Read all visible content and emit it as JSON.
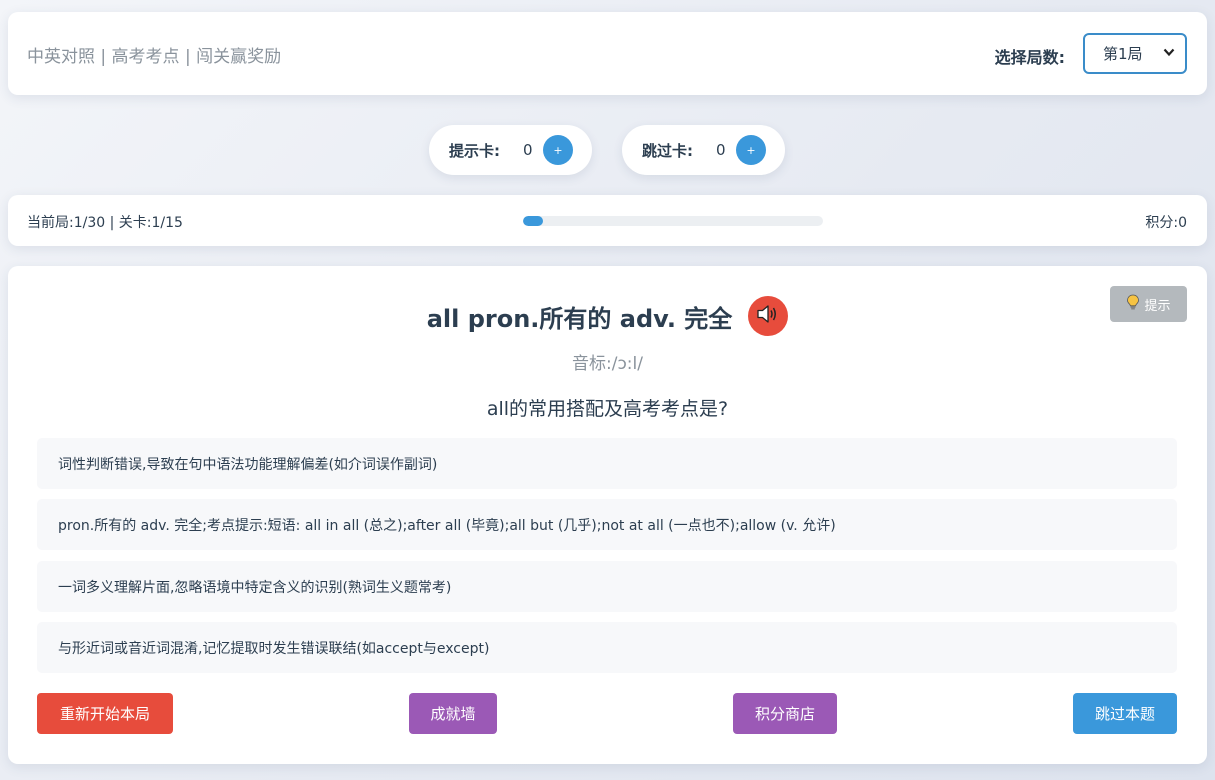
{
  "header": {
    "subtitle": "中英对照 | 高考考点 | 闯关赢奖励",
    "round_label": "选择局数:",
    "round_selected": "第1局"
  },
  "cards": {
    "hint_label": "提示卡:",
    "hint_count": "0",
    "skip_label": "跳过卡:",
    "skip_count": "0",
    "plus_symbol": "+"
  },
  "progress": {
    "text": "当前局:1/30 | 关卡:1/15",
    "fraction": 0.0667,
    "score_text": "积分:0"
  },
  "question": {
    "hint_button": "提示",
    "word": "all pron.所有的 adv. 完全",
    "phonetic": "音标:/ɔ:l/",
    "prompt": "all的常用搭配及高考考点是?",
    "options": [
      "词性判断错误,导致在句中语法功能理解偏差(如介词误作副词)",
      "pron.所有的 adv. 完全;考点提示:短语: all in all (总之);after all (毕竟);all but (几乎);not at all (一点也不);allow (v. 允许)",
      "一词多义理解片面,忽略语境中特定含义的识别(熟词生义题常考)",
      "与形近词或音近词混淆,记忆提取时发生错误联结(如accept与except)"
    ]
  },
  "actions": {
    "restart": "重新开始本局",
    "achievements": "成就墙",
    "shop": "积分商店",
    "skip": "跳过本题"
  },
  "colors": {
    "primary": "#3a98db",
    "danger": "#e74c3c",
    "purple": "#9b59b6",
    "hint_gray": "#b4b9bd"
  },
  "icons": {
    "speaker": "speaker-icon",
    "bulb": "lightbulb-icon",
    "select": "chevron-down-icon"
  }
}
